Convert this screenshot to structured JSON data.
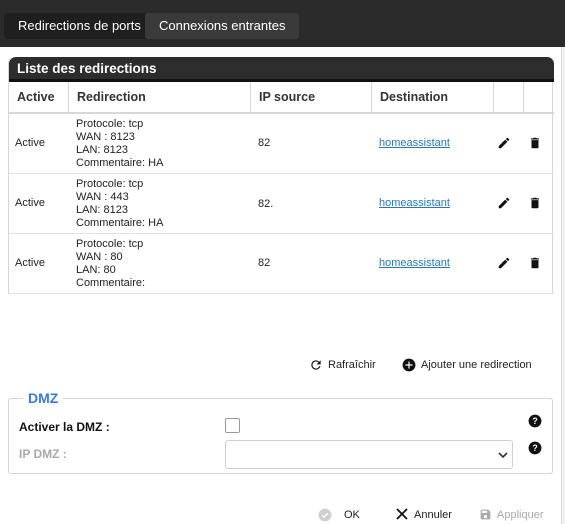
{
  "tabs": [
    {
      "label": "Redirections de ports",
      "active": true
    },
    {
      "label": "Connexions entrantes",
      "active": false
    }
  ],
  "card": {
    "title": "Liste des redirections"
  },
  "table": {
    "headers": [
      "Active",
      "Redirection",
      "IP source",
      "Destination",
      "",
      ""
    ],
    "rows": [
      {
        "status": "Active",
        "protocol": "Protocole: tcp",
        "wan": "WAN : 8123",
        "lan": "LAN: 8123",
        "comment": "Commentaire: HA",
        "ip": "82",
        "destination": "homeassistant"
      },
      {
        "status": "Active",
        "protocol": "Protocole: tcp",
        "wan": "WAN : 443",
        "lan": "LAN: 8123",
        "comment": "Commentaire: HA",
        "ip": "82.",
        "destination": "homeassistant"
      },
      {
        "status": "Active",
        "protocol": "Protocole: tcp",
        "wan": "WAN : 80",
        "lan": "LAN: 80",
        "comment": "Commentaire:",
        "ip": "82",
        "destination": "homeassistant"
      }
    ]
  },
  "actions": {
    "refresh": "Rafraîchir",
    "add": "Ajouter une redirection"
  },
  "dmz": {
    "legend": "DMZ",
    "enable_label": "Activer la DMZ :",
    "ip_label": "IP DMZ :",
    "enabled": false,
    "ip_value": ""
  },
  "buttons": {
    "ok": "OK",
    "cancel": "Annuler",
    "apply": "Appliquer"
  },
  "colors": {
    "topbar": "#2b2b2b",
    "accent": "#3a7bd5",
    "link": "#2a78b8"
  }
}
